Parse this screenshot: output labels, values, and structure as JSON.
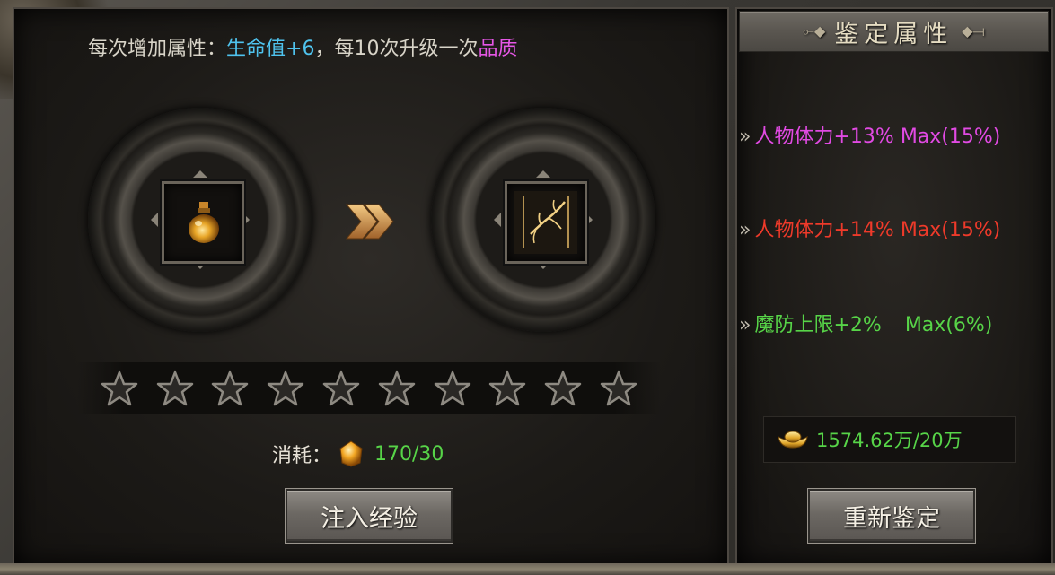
{
  "info": {
    "prefix": "每次增加属性：",
    "attr_name": "生命值+6",
    "middle": "，每10次升级一次",
    "quality": "品质"
  },
  "items": {
    "current_icon": "potion-icon",
    "next_icon": "branch-icon",
    "arrow_icon": "double-chevron-right-icon"
  },
  "stars": {
    "total": 10,
    "filled": 0
  },
  "cost": {
    "label": "消耗：",
    "icon": "gem-icon",
    "value": "170/30"
  },
  "buttons": {
    "inject_label": "注入经验",
    "reidentify_label": "重新鉴定"
  },
  "right": {
    "title": "鉴定属性",
    "attributes": [
      {
        "prefix": "»",
        "name": "人物体力+13%",
        "max": "Max(15%)",
        "color": "#e14ae3"
      },
      {
        "prefix": "»",
        "name": "人物体力+14%",
        "max": "Max(15%)",
        "color": "#ee3a2a"
      },
      {
        "prefix": "»",
        "name": "魔防上限+2%",
        "max": "Max(6%)",
        "color": "#57d448"
      }
    ],
    "gold": {
      "icon": "gold-ingot-icon",
      "value": "1574.62万/20万"
    }
  },
  "colors": {
    "cyan": "#4fc3ee",
    "pink": "#e657e6",
    "green": "#57d448"
  }
}
